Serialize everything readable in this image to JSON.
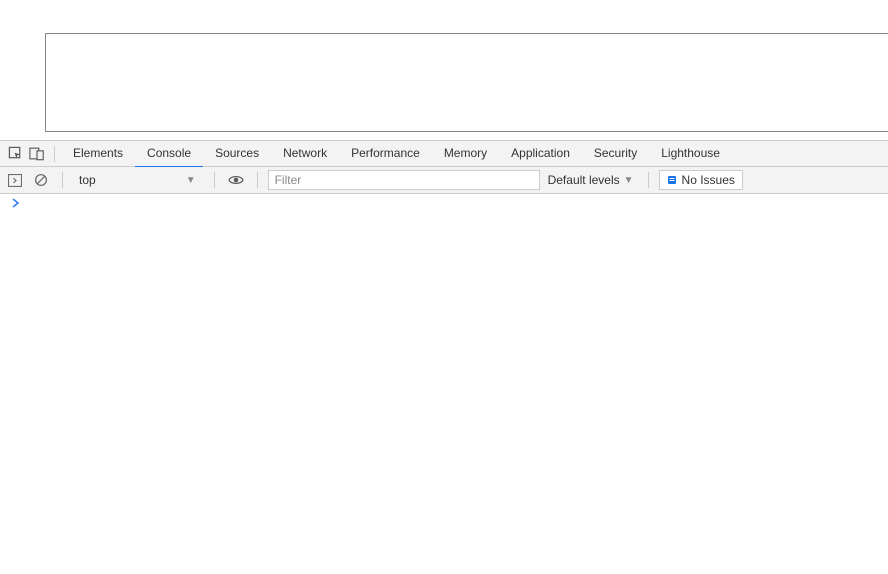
{
  "tabs": {
    "elements": "Elements",
    "console": "Console",
    "sources": "Sources",
    "network": "Network",
    "performance": "Performance",
    "memory": "Memory",
    "application": "Application",
    "security": "Security",
    "lighthouse": "Lighthouse"
  },
  "toolbar": {
    "context": "top",
    "filter_placeholder": "Filter",
    "levels": "Default levels",
    "issues": "No Issues"
  },
  "prompt": ">"
}
